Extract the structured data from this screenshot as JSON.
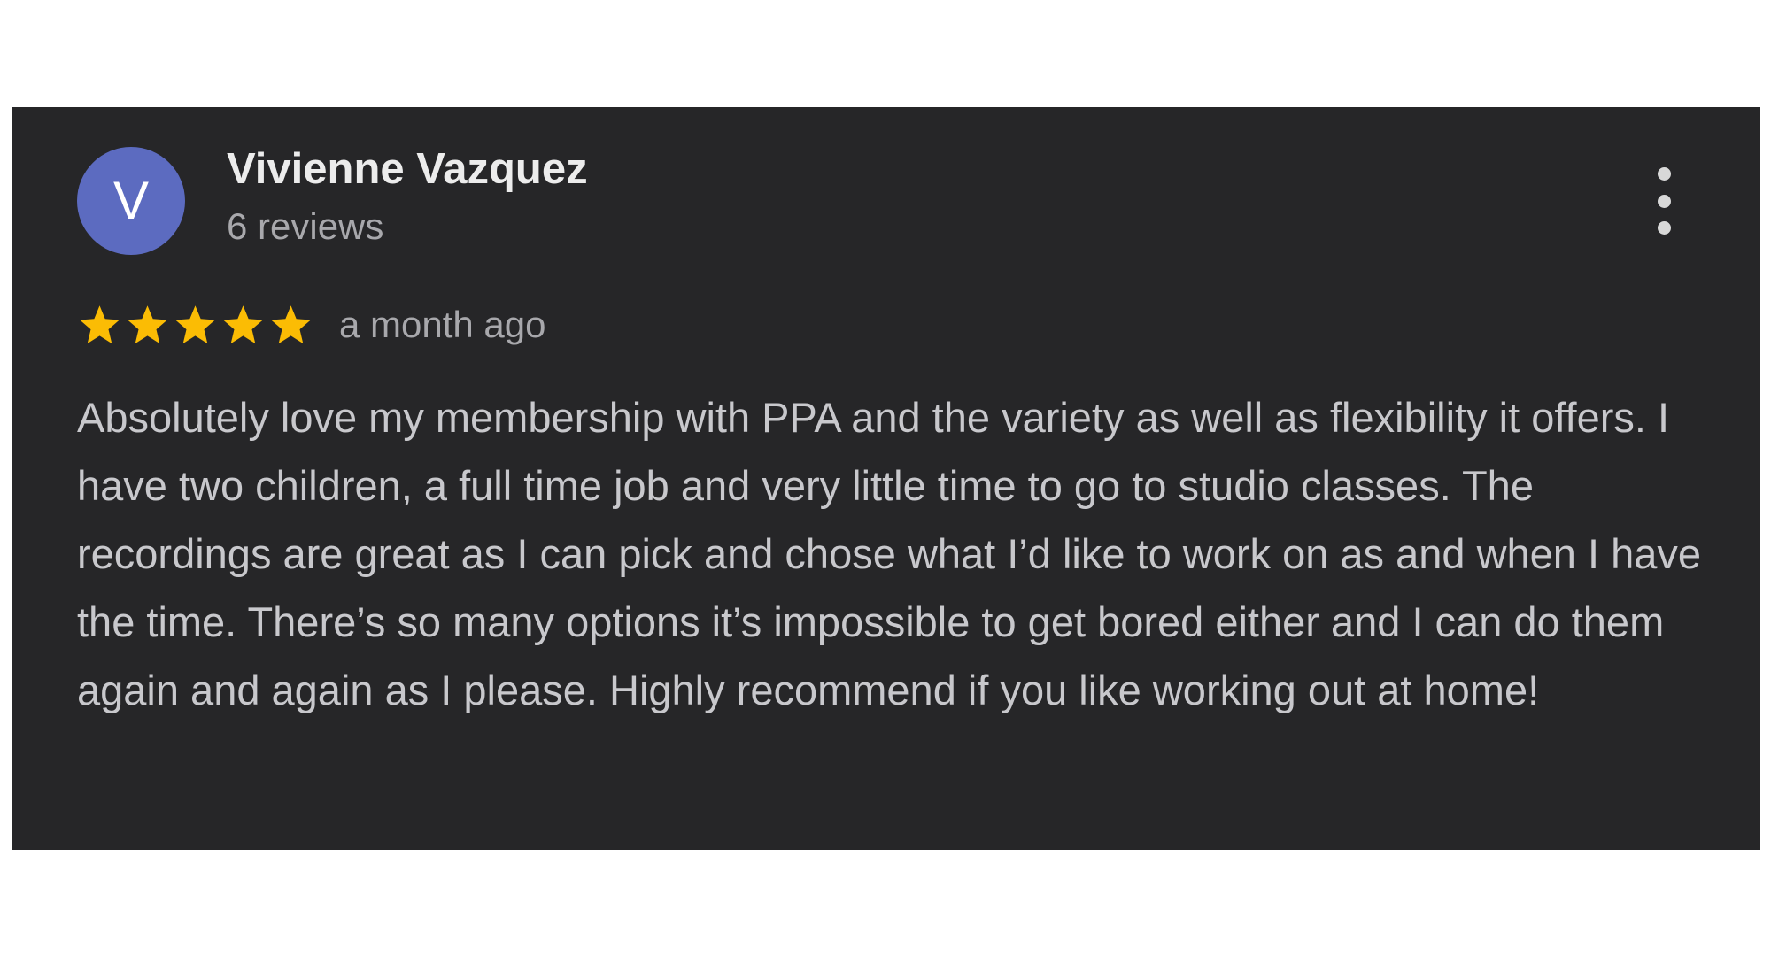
{
  "review": {
    "avatar_letter": "V",
    "avatar_color": "#5c6bc0",
    "reviewer_name": "Vivienne Vazquez",
    "review_count": "6 reviews",
    "rating": 5,
    "rating_max": 5,
    "star_color": "#fbbc04",
    "date": "a month ago",
    "text": "Absolutely love my membership with PPA and the variety as well as flexibility it offers. I have two children, a full time job and very little time to go to studio classes. The recordings are great as I can pick and chose what I’d like to work on as and when I have the time. There’s so many options it’s impossible to get bored either and I can do them again and again as I please. Highly recommend if you like working out at home!",
    "more_icon": "more-vertical-icon"
  },
  "theme": {
    "card_background": "#262628",
    "page_background": "#ffffff"
  }
}
